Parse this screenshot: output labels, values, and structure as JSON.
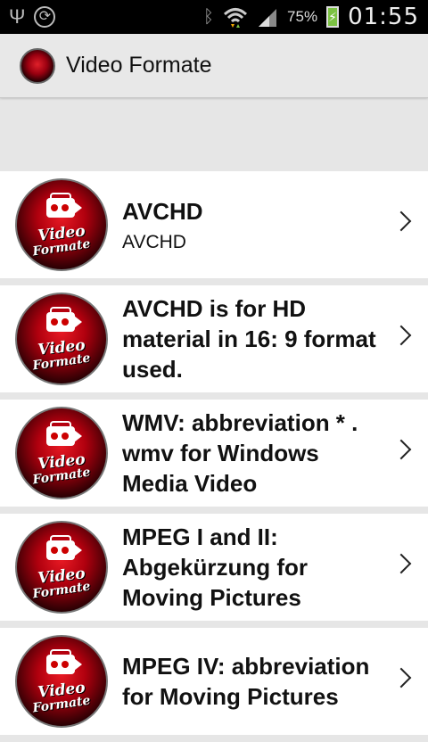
{
  "status_bar": {
    "battery_percent": "75%",
    "time": "01:55"
  },
  "action_bar": {
    "title": "Video Formate"
  },
  "list": {
    "items": [
      {
        "title": "AVCHD",
        "subtitle": "AVCHD"
      },
      {
        "title": "AVCHD is for HD material in 16: 9 format used.",
        "subtitle": ""
      },
      {
        "title": "WMV: abbreviation * . wmv for Windows Media Video",
        "subtitle": ""
      },
      {
        "title": "MPEG I and II: Abgekürzung for Moving Pictures",
        "subtitle": ""
      },
      {
        "title": "MPEG IV: abbreviation for Moving Pictures",
        "subtitle": ""
      }
    ]
  },
  "logo": {
    "line1": "Video",
    "line2": "Formate"
  },
  "colors": {
    "accent_red": "#c8101e",
    "bar_bg": "#e8e8e8",
    "list_bg": "#ffffff"
  }
}
